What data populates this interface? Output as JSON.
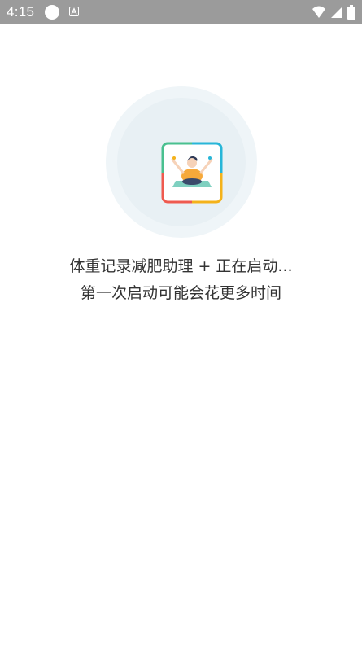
{
  "status_bar": {
    "time": "4:15",
    "icons": [
      "circle-notification-icon",
      "a-notification-icon",
      "wifi-icon",
      "signal-icon",
      "battery-icon"
    ]
  },
  "splash": {
    "logo_icon": "yoga-app-icon",
    "loading_text": "体重记录减肥助理 + 正在启动...",
    "hint_text": "第一次启动可能会花更多时间"
  },
  "colors": {
    "status_bar_bg": "#9b9b9b",
    "logo_circle": "#eff5f8",
    "text": "#333333"
  }
}
